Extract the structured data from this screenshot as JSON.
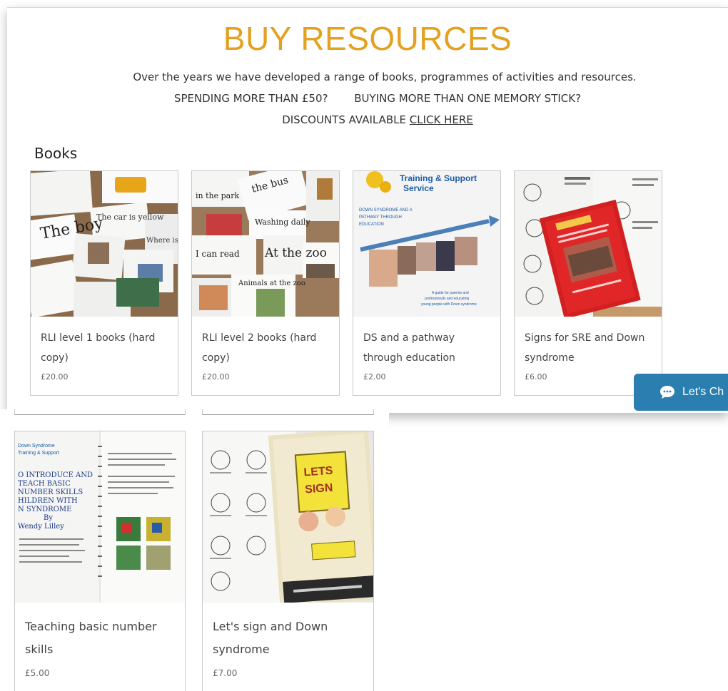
{
  "header": {
    "title": "BUY RESOURCES",
    "intro": "Over the years we have developed a range of books, programmes of activities and resources.",
    "spend_text": "SPENDING MORE THAN £50?",
    "buying_text": "BUYING MORE THAN ONE MEMORY STICK?",
    "discount_text": "DISCOUNTS AVAILABLE",
    "discount_link": "CLICK HERE"
  },
  "section_title": "Books",
  "products": [
    {
      "name": "RLI level 1 books (hard copy)",
      "price": "£20.00"
    },
    {
      "name": "RLI level 2 books (hard copy)",
      "price": "£20.00"
    },
    {
      "name": "DS and a pathway through education",
      "price": "£2.00"
    },
    {
      "name": "Signs for SRE and Down syndrome",
      "price": "£6.00"
    },
    {
      "name": "Teaching basic number skills",
      "price": "£5.00"
    },
    {
      "name": "Let's sign and Down syndrome",
      "price": "£7.00"
    }
  ],
  "chat": {
    "label": "Let's Ch",
    "icon": "chat-bubble-icon"
  },
  "colors": {
    "title": "#e3a11f",
    "chat": "#2a7fb0"
  }
}
